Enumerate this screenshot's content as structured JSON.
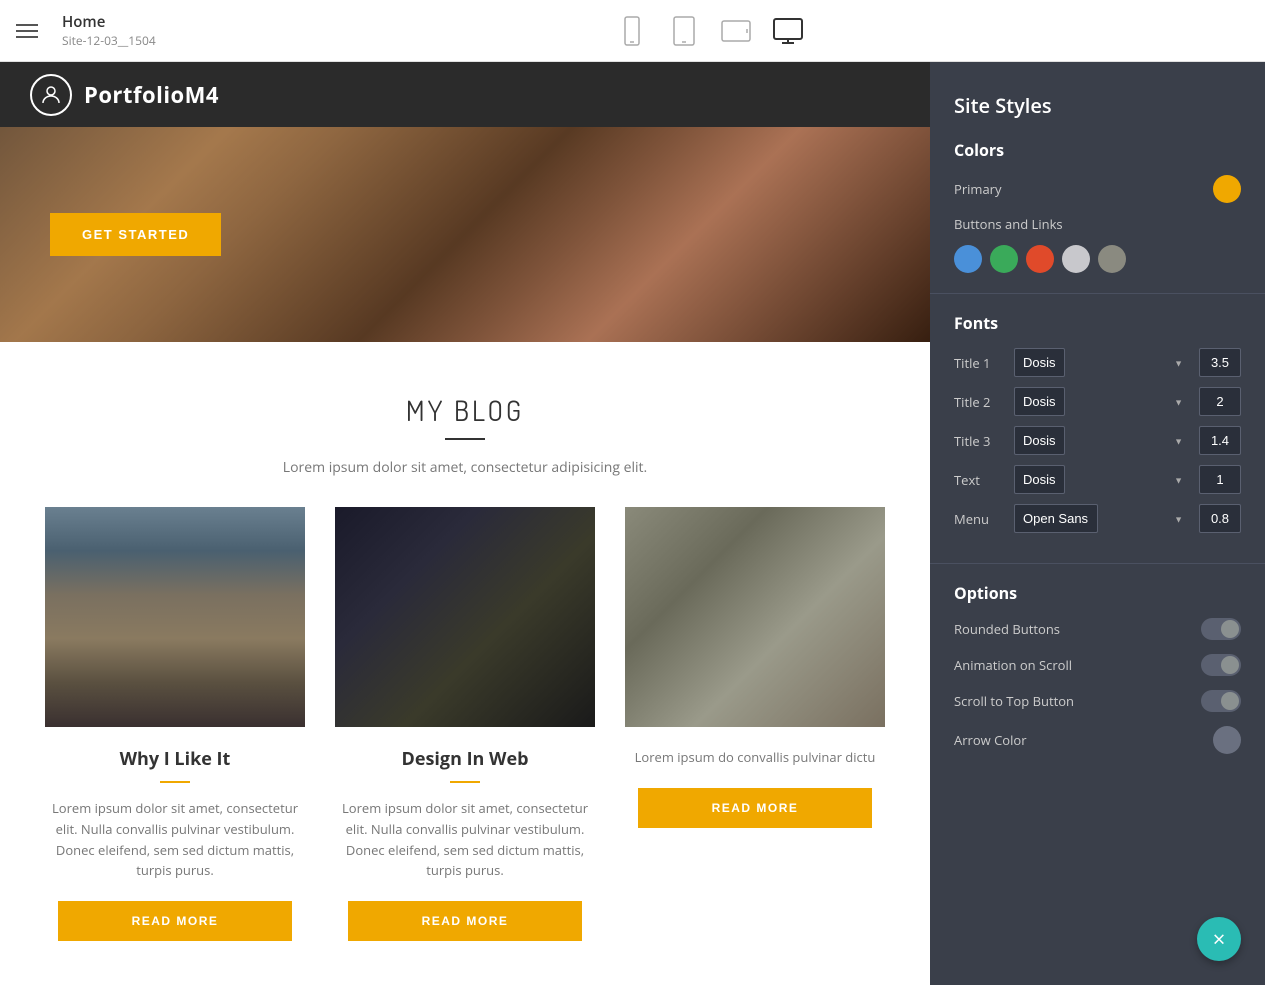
{
  "topbar": {
    "hamburger_label": "menu",
    "page_title": "Home",
    "page_subtitle": "Site-12-03__1504",
    "device_icons": [
      {
        "name": "mobile-icon",
        "label": "Mobile"
      },
      {
        "name": "tablet-icon",
        "label": "Tablet"
      },
      {
        "name": "tablet-landscape-icon",
        "label": "Tablet Landscape"
      },
      {
        "name": "desktop-icon",
        "label": "Desktop",
        "active": true
      }
    ]
  },
  "site_preview": {
    "logo_text": "PortfolioM4",
    "hero_button": "GET STARTED",
    "blog_heading": "MY BLOG",
    "blog_subtitle": "Lorem ipsum dolor sit amet, consectetur adipisicing elit.",
    "cards": [
      {
        "title": "Why I Like It",
        "text": "Lorem ipsum dolor sit amet, consectetur elit. Nulla convallis pulvinar vestibulum. Donec eleifend, sem sed dictum mattis, turpis purus.",
        "read_more": "READ MORE",
        "photo_class": "photo-road"
      },
      {
        "title": "Design In Web",
        "text": "Lorem ipsum dolor sit amet, consectetur elit. Nulla convallis pulvinar vestibulum. Donec eleifend, sem sed dictum mattis, turpis purus.",
        "read_more": "READ MORE",
        "photo_class": "photo-office"
      },
      {
        "title": "",
        "text": "Lorem ipsum do convallis pulvinar dictu",
        "read_more": "READ MORE",
        "photo_class": "photo-camera"
      }
    ]
  },
  "right_panel": {
    "title": "Site Styles",
    "colors_section": {
      "label": "Colors",
      "primary_label": "Primary",
      "primary_color": "#f0a800",
      "buttons_links_label": "Buttons and Links",
      "swatches": [
        {
          "color": "#4a90d9",
          "name": "blue"
        },
        {
          "color": "#3aaa5a",
          "name": "green"
        },
        {
          "color": "#e04a2a",
          "name": "red"
        },
        {
          "color": "#c8c8cc",
          "name": "light-gray"
        },
        {
          "color": "#8a8a80",
          "name": "gray"
        }
      ]
    },
    "fonts_section": {
      "label": "Fonts",
      "rows": [
        {
          "label": "Title 1",
          "font": "Dosis",
          "value": "3.5"
        },
        {
          "label": "Title 2",
          "font": "Dosis",
          "value": "2"
        },
        {
          "label": "Title 3",
          "font": "Dosis",
          "value": "1.4"
        },
        {
          "label": "Text",
          "font": "Dosis",
          "value": "1"
        },
        {
          "label": "Menu",
          "font": "Open Sans",
          "value": "0.8"
        }
      ]
    },
    "options_section": {
      "label": "Options",
      "options": [
        {
          "label": "Rounded Buttons",
          "on": false
        },
        {
          "label": "Animation on Scroll",
          "on": false
        },
        {
          "label": "Scroll to Top Button",
          "on": false
        },
        {
          "label": "Arrow Color",
          "type": "color"
        }
      ]
    }
  },
  "fab": {
    "icon": "×",
    "label": "close"
  }
}
